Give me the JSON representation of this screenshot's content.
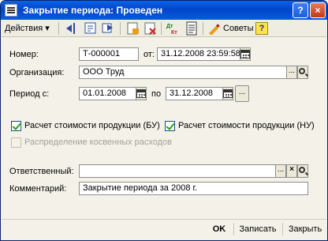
{
  "window": {
    "title": "Закрытие периода: Проведен",
    "help_label": "?",
    "close_label": "×"
  },
  "toolbar": {
    "actions_label": "Действия ▾",
    "tips_label": "Советы",
    "help_label": "?"
  },
  "form": {
    "number_label": "Номер:",
    "number_value": "Т-000001",
    "from_label": "от:",
    "date_value": "31.12.2008 23:59:58",
    "org_label": "Организация:",
    "org_value": "ООО Труд",
    "period_label": "Период с:",
    "period_from": "01.01.2008",
    "period_to_label": "по",
    "period_to": "31.12.2008",
    "cb1_label": "Расчет стоимости продукции (БУ)",
    "cb2_label": "Расчет стоимости продукции (НУ)",
    "cb3_label": "Распределение косвенных расходов",
    "resp_label": "Ответственный:",
    "resp_value": "",
    "comment_label": "Комментарий:",
    "comment_value": "Закрытие периода за 2008 г."
  },
  "buttons": {
    "select": "...",
    "clear": "×",
    "ok": "OK",
    "save": "Записать",
    "close": "Закрыть"
  }
}
